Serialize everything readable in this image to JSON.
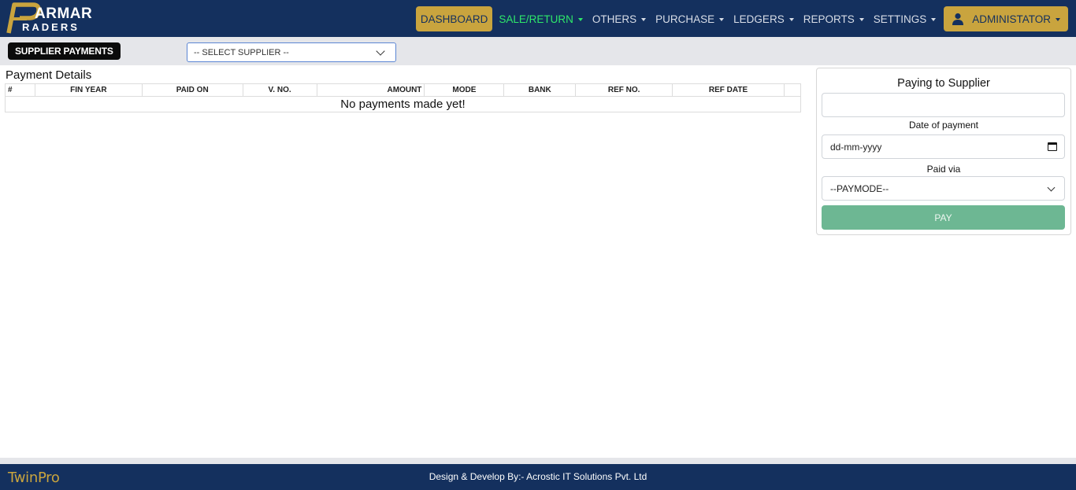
{
  "brand": {
    "logo_line1": "ARMAR",
    "logo_line2": "RADERS",
    "color_navy": "#14305e",
    "color_gold": "#c9a43e"
  },
  "nav": {
    "dashboard": "DASHBOARD",
    "sale_return": "SALE/RETURN",
    "others": "OTHERS",
    "purchase": "PURCHASE",
    "ledgers": "LEDGERS",
    "reports": "REPORTS",
    "settings": "SETTINGS",
    "admin": "ADMINISTATOR",
    "active_color": "#2ee86a"
  },
  "subheader": {
    "badge": "SUPPLIER PAYMENTS",
    "supplier_select_value": "-- SELECT SUPPLIER --"
  },
  "payment_details": {
    "title": "Payment Details",
    "columns": [
      "#",
      "FIN YEAR",
      "PAID ON",
      "V. NO.",
      "AMOUNT",
      "MODE",
      "BANK",
      "REF NO.",
      "REF DATE",
      ""
    ],
    "empty_message": "No payments made yet!"
  },
  "panel": {
    "title": "Paying to Supplier",
    "supplier_value": "",
    "date_label": "Date of payment",
    "date_placeholder": "dd-mm-yyyy",
    "paid_via_label": "Paid via",
    "paymode_value": "--PAYMODE--",
    "pay_button": "PAY",
    "pay_button_color": "#6db793"
  },
  "footer": {
    "brand": "TwinPro",
    "credit": "Design & Develop By:- Acrostic IT Solutions Pvt. Ltd"
  }
}
